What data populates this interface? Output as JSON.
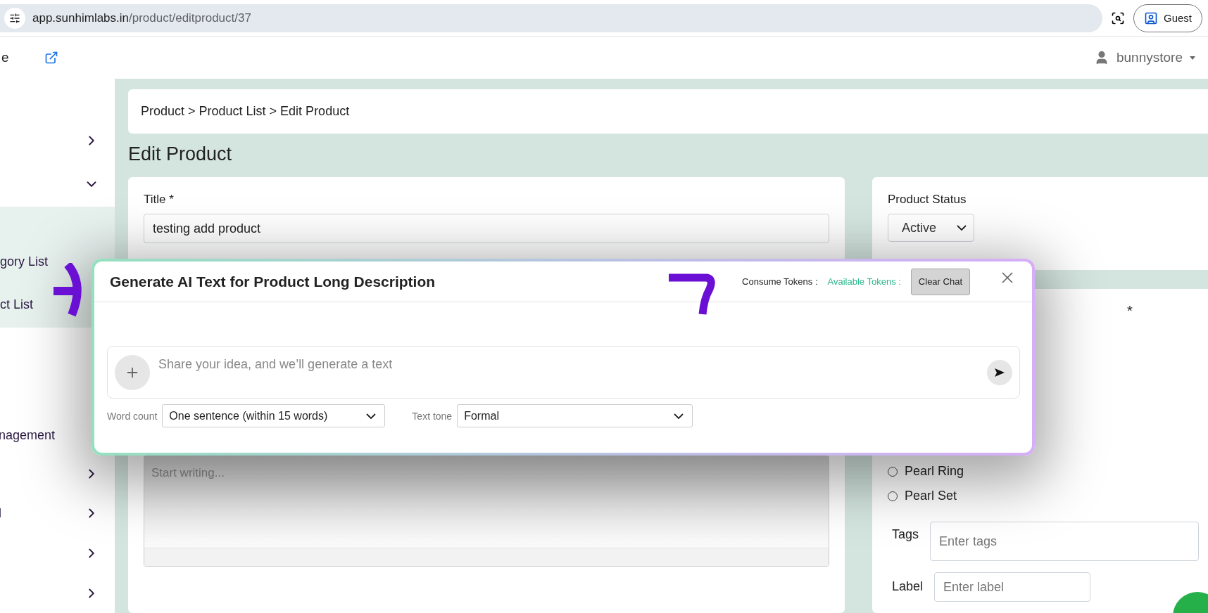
{
  "browser": {
    "url_host": "app.sunhimlabs.in",
    "url_path": "/product/editproduct/37",
    "profile_label": "Guest"
  },
  "header": {
    "cut_label": "e",
    "user": "bunnystore"
  },
  "sidebar": {
    "items": [
      {
        "kind": "group",
        "expanded": false
      },
      {
        "kind": "group",
        "expanded": true,
        "children": [
          {
            "label": "gory List"
          },
          {
            "label": "ct List"
          }
        ]
      },
      {
        "kind": "link",
        "label": "nagement"
      },
      {
        "kind": "group",
        "expanded": false
      },
      {
        "kind": "group",
        "label": "l",
        "expanded": false
      },
      {
        "kind": "group",
        "expanded": false
      },
      {
        "kind": "group",
        "expanded": false
      }
    ]
  },
  "breadcrumb": "Product > Product List > Edit Product",
  "page_title": "Edit Product",
  "left_card": {
    "title_field": {
      "label": "Title *",
      "value": "testing add product"
    },
    "editor": {
      "placeholder": "Start writing..."
    }
  },
  "right_card": {
    "status": {
      "label": "Product Status",
      "value": "Active"
    },
    "partial_label": "*",
    "radios": [
      {
        "label": "Pearl Ring",
        "selected": false
      },
      {
        "label": "Pearl Set",
        "selected": false
      }
    ],
    "tags": {
      "label": "Tags",
      "placeholder": "Enter tags"
    },
    "label_field": {
      "label": "Label",
      "placeholder": "Enter label"
    }
  },
  "modal": {
    "title": "Generate AI Text for Product Long Description",
    "consume_tokens": "Consume Tokens :",
    "available_tokens": "Available Tokens :",
    "clear_button": "Clear Chat",
    "prompt_placeholder": "Share your idea, and we’ll generate a text",
    "word_count": {
      "label": "Word count",
      "value": "One sentence (within 15 words)"
    },
    "text_tone": {
      "label": "Text tone",
      "value": "Formal"
    }
  }
}
